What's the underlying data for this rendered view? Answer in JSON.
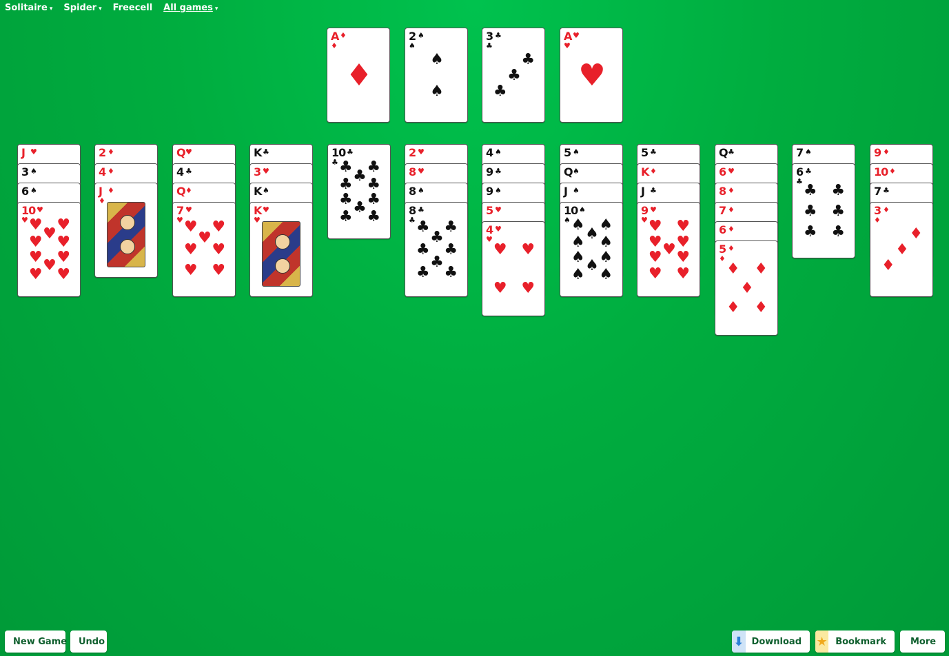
{
  "nav": {
    "items": [
      {
        "label": "Solitaire",
        "caret": "▾",
        "underline": false
      },
      {
        "label": "Spider",
        "caret": "▾",
        "underline": false
      },
      {
        "label": "Freecell",
        "caret": "",
        "underline": false
      },
      {
        "label": "All games",
        "caret": "▾",
        "underline": true
      }
    ]
  },
  "foundations": [
    {
      "rank": "A",
      "suit": "♦"
    },
    {
      "rank": "2",
      "suit": "♠"
    },
    {
      "rank": "3",
      "suit": "♣"
    },
    {
      "rank": "A",
      "suit": "♥"
    }
  ],
  "tableau": [
    [
      {
        "rank": "J",
        "suit": "♥"
      },
      {
        "rank": "3",
        "suit": "♠"
      },
      {
        "rank": "6",
        "suit": "♠"
      },
      {
        "rank": "10",
        "suit": "♥"
      }
    ],
    [
      {
        "rank": "2",
        "suit": "♦"
      },
      {
        "rank": "4",
        "suit": "♦"
      },
      {
        "rank": "J",
        "suit": "♦"
      }
    ],
    [
      {
        "rank": "Q",
        "suit": "♥"
      },
      {
        "rank": "4",
        "suit": "♣"
      },
      {
        "rank": "Q",
        "suit": "♦"
      },
      {
        "rank": "7",
        "suit": "♥"
      }
    ],
    [
      {
        "rank": "K",
        "suit": "♣"
      },
      {
        "rank": "3",
        "suit": "♥"
      },
      {
        "rank": "K",
        "suit": "♠"
      },
      {
        "rank": "K",
        "suit": "♥"
      }
    ],
    [
      {
        "rank": "10",
        "suit": "♣"
      }
    ],
    [
      {
        "rank": "2",
        "suit": "♥"
      },
      {
        "rank": "8",
        "suit": "♥"
      },
      {
        "rank": "8",
        "suit": "♠"
      },
      {
        "rank": "8",
        "suit": "♣"
      }
    ],
    [
      {
        "rank": "4",
        "suit": "♠"
      },
      {
        "rank": "9",
        "suit": "♣"
      },
      {
        "rank": "9",
        "suit": "♠"
      },
      {
        "rank": "5",
        "suit": "♥"
      },
      {
        "rank": "4",
        "suit": "♥"
      }
    ],
    [
      {
        "rank": "5",
        "suit": "♠"
      },
      {
        "rank": "Q",
        "suit": "♠"
      },
      {
        "rank": "J",
        "suit": "♠"
      },
      {
        "rank": "10",
        "suit": "♠"
      }
    ],
    [
      {
        "rank": "5",
        "suit": "♣"
      },
      {
        "rank": "K",
        "suit": "♦"
      },
      {
        "rank": "J",
        "suit": "♣"
      },
      {
        "rank": "9",
        "suit": "♥"
      }
    ],
    [
      {
        "rank": "Q",
        "suit": "♣"
      },
      {
        "rank": "6",
        "suit": "♥"
      },
      {
        "rank": "8",
        "suit": "♦"
      },
      {
        "rank": "7",
        "suit": "♦"
      },
      {
        "rank": "6",
        "suit": "♦"
      },
      {
        "rank": "5",
        "suit": "♦"
      }
    ],
    [
      {
        "rank": "7",
        "suit": "♠"
      },
      {
        "rank": "6",
        "suit": "♣"
      }
    ],
    [
      {
        "rank": "9",
        "suit": "♦"
      },
      {
        "rank": "10",
        "suit": "♦"
      },
      {
        "rank": "7",
        "suit": "♣"
      },
      {
        "rank": "3",
        "suit": "♦"
      }
    ]
  ],
  "buttons": {
    "new_game": "New Game",
    "undo": "Undo",
    "download": "Download",
    "bookmark": "Bookmark",
    "more": "More"
  },
  "colors": {
    "felt": "#00ad3f",
    "red_suit": "#e8202a",
    "black_suit": "#111111",
    "button_text": "#0f5f2e",
    "download_icon_bg": "#cfe3f7",
    "bookmark_icon_bg": "#fbe9a0"
  }
}
